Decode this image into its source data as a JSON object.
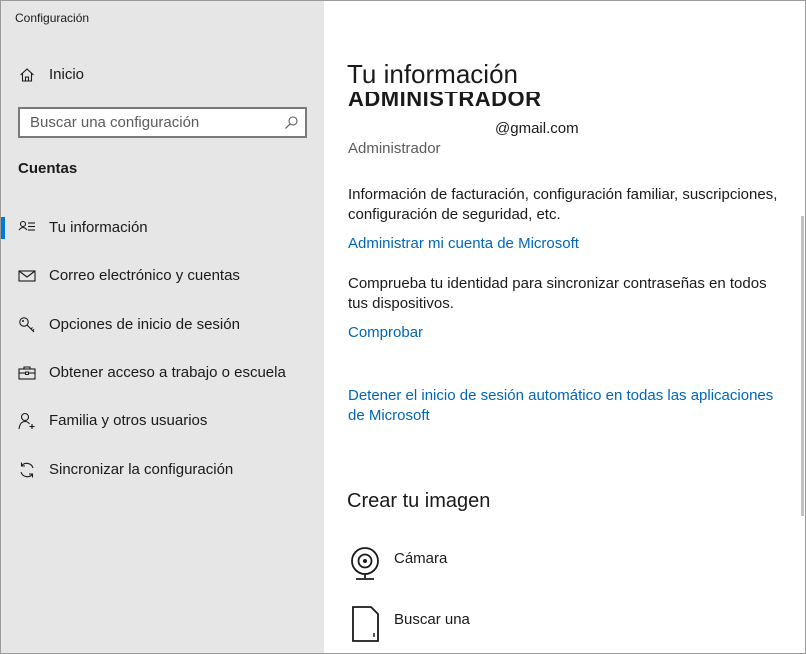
{
  "window": {
    "title": "Configuración",
    "minimize_icon": "minimize-icon",
    "maximize_icon": "maximize-icon",
    "close_icon": "close-icon"
  },
  "sidebar": {
    "home_label": "Inicio",
    "search": {
      "placeholder": "Buscar una configuración",
      "value": ""
    },
    "section_title": "Cuentas",
    "items": [
      {
        "label": "Tu información",
        "icon": "person-card-icon",
        "selected": true
      },
      {
        "label": "Correo electrónico y cuentas",
        "icon": "mail-icon",
        "selected": false
      },
      {
        "label": "Opciones de inicio de sesión",
        "icon": "key-icon",
        "selected": false
      },
      {
        "label": "Obtener acceso a trabajo o escuela",
        "icon": "briefcase-icon",
        "selected": false
      },
      {
        "label": "Familia y otros usuarios",
        "icon": "person-add-icon",
        "selected": false
      },
      {
        "label": "Sincronizar la configuración",
        "icon": "sync-icon",
        "selected": false
      }
    ],
    "accent_color": "#0078d7"
  },
  "main": {
    "title": "Tu información",
    "account": {
      "name": "ADMINISTRADOR",
      "email": "@gmail.com",
      "role": "Administrador"
    },
    "billing_text": "Información de facturación, configuración familiar, suscripciones, configuración de seguridad, etc.",
    "manage_link": "Administrar mi cuenta de Microsoft",
    "verify_text": "Comprueba tu identidad para sincronizar contraseñas en todos tus dispositivos.",
    "verify_link": "Comprobar",
    "stop_signin_link": "Detener el inicio de sesión automático en todas las aplicaciones de Microsoft",
    "create_image_title": "Crear tu imagen",
    "image_options": [
      {
        "label": "Cámara",
        "icon": "webcam-icon"
      },
      {
        "label": "Buscar una",
        "icon": "browse-file-icon"
      }
    ],
    "link_color": "#0067b8"
  }
}
